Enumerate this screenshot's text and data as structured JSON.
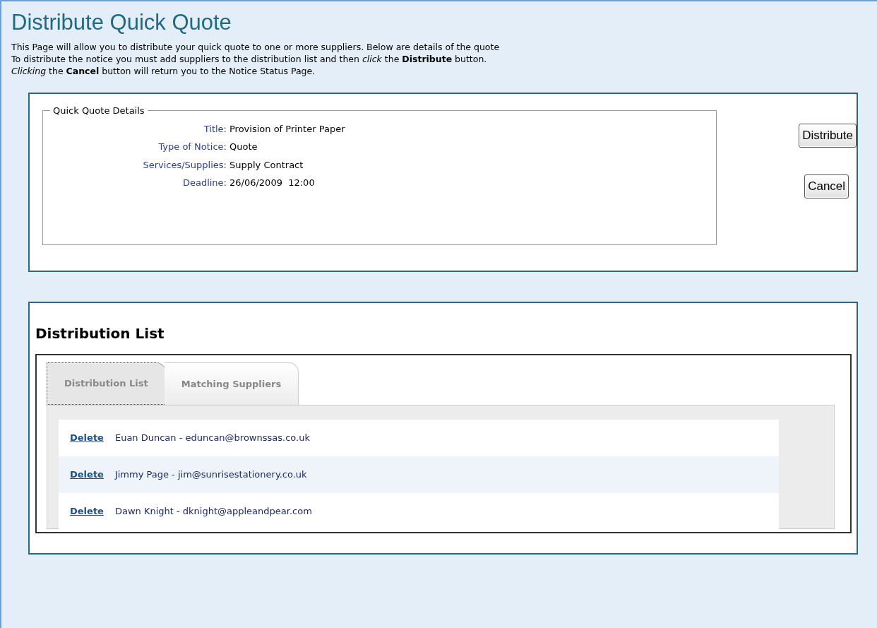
{
  "page_title": "Distribute Quick Quote",
  "intro_lines": [
    "This Page will allow you to distribute your quick quote to one or more suppliers. Below are details of the quote",
    "To distribute the notice you must add suppliers to the distribution list and then *click* the **Distribute** button.",
    "*Clicking* the **Cancel** button will return you to the Notice Status Page."
  ],
  "details": {
    "legend": "Quick Quote Details",
    "fields": [
      {
        "label": "Title:",
        "value": "Provision of Printer Paper"
      },
      {
        "label": "Type of Notice:",
        "value": "Quote"
      },
      {
        "label": "Services/Supplies:",
        "value": "Supply Contract"
      },
      {
        "label": "Deadline:",
        "value": "26/06/2009  12:00"
      }
    ]
  },
  "buttons": [
    "Distribute",
    "Cancel"
  ],
  "distribution": {
    "heading": "Distribution List",
    "tabs": [
      {
        "label": "Distribution List",
        "selected": true
      },
      {
        "label": "Matching Suppliers",
        "selected": false
      }
    ],
    "rows": [
      {
        "action": "Delete",
        "supplier": "Euan Duncan - eduncan@brownssas.co.uk"
      },
      {
        "action": "Delete",
        "supplier": "Jimmy Page - jim@sunrisestationery.co.uk"
      },
      {
        "action": "Delete",
        "supplier": "Dawn Knight - dknight@appleandpear.com"
      }
    ]
  }
}
